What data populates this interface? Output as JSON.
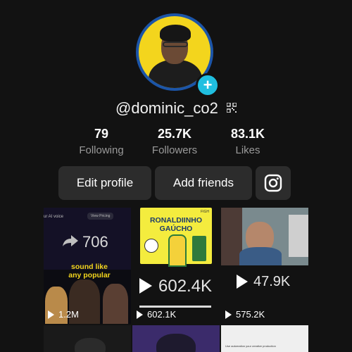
{
  "profile": {
    "username": "@dominic_co2",
    "following_count": "79",
    "following_label": "Following",
    "followers_count": "25.7K",
    "followers_label": "Followers",
    "likes_count": "83.1K",
    "likes_label": "Likes"
  },
  "actions": {
    "edit_profile": "Edit profile",
    "add_friends": "Add friends",
    "instagram_icon": "instagram-icon"
  },
  "grid": {
    "tile1": {
      "top_text": "ur AI voice",
      "badge": "View Pricing",
      "share_count": "706",
      "caption": "sound like any popular",
      "views": "1.2M"
    },
    "tile2": {
      "title1": "RONALDIINHO",
      "title2": "GAÚCHO",
      "badge": "FIGH",
      "big_count": "602.4K",
      "views": "602.1K"
    },
    "tile3": {
      "big_count": "47.9K",
      "views": "575.2K"
    },
    "tile6_caption": "Use automation your creative production"
  },
  "colors": {
    "background": "#121212",
    "button_bg": "#2c2c2c",
    "accent": "#20bfe0",
    "avatar_ring": "#1c55a8",
    "avatar_bg": "#f3d51d"
  }
}
